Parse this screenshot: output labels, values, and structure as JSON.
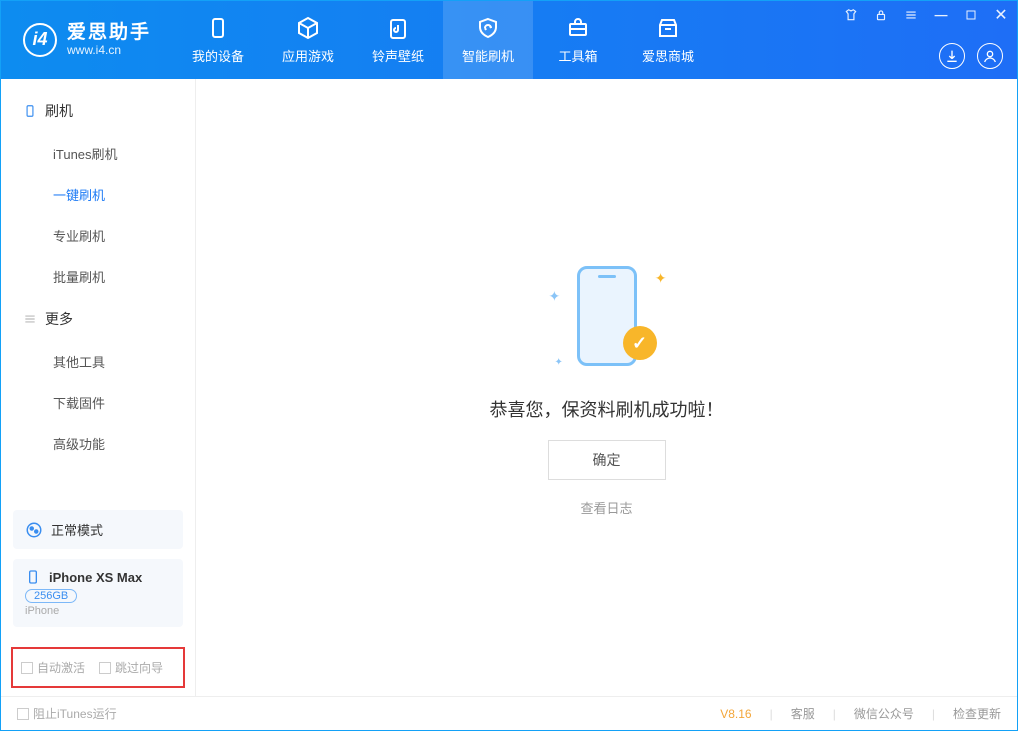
{
  "app": {
    "title": "爱思助手",
    "subtitle": "www.i4.cn"
  },
  "tabs": {
    "device": "我的设备",
    "apps": "应用游戏",
    "ringtone": "铃声壁纸",
    "flash": "智能刷机",
    "toolbox": "工具箱",
    "store": "爱思商城"
  },
  "sidebar": {
    "section_flash": "刷机",
    "items_flash": {
      "itunes": "iTunes刷机",
      "onekey": "一键刷机",
      "pro": "专业刷机",
      "batch": "批量刷机"
    },
    "section_more": "更多",
    "items_more": {
      "other": "其他工具",
      "firmware": "下载固件",
      "advanced": "高级功能"
    },
    "mode": "正常模式",
    "device_name": "iPhone XS Max",
    "device_cap": "256GB",
    "device_type": "iPhone",
    "chk_activate": "自动激活",
    "chk_skip": "跳过向导"
  },
  "main": {
    "message": "恭喜您，保资料刷机成功啦！",
    "ok": "确定",
    "log": "查看日志"
  },
  "footer": {
    "block": "阻止iTunes运行",
    "version": "V8.16",
    "cs": "客服",
    "wechat": "微信公众号",
    "update": "检查更新"
  }
}
